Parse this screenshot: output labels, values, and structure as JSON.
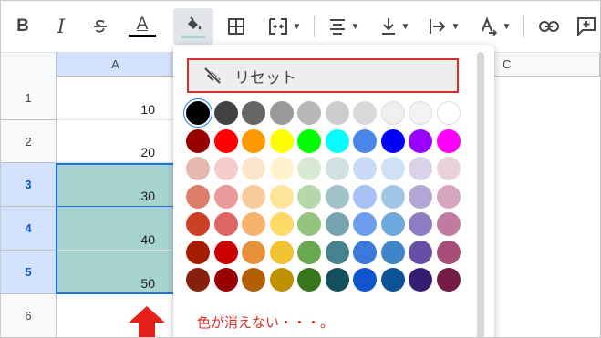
{
  "toolbar": {
    "bold": "B",
    "italic": "I",
    "text_color_letter": "A",
    "text_color_bar": "#000000",
    "fill_bar": "#a6d3cf",
    "buttons": [
      "bold-icon",
      "italic-icon",
      "strikethrough-icon",
      "text-color-icon",
      "fill-color-icon",
      "borders-icon",
      "merge-cells-icon",
      "horizontal-align-icon",
      "vertical-align-icon",
      "text-wrapping-icon",
      "text-rotation-icon",
      "insert-link-icon",
      "insert-comment-icon"
    ]
  },
  "columns": [
    {
      "label": "A",
      "selected": true
    },
    {
      "label": "C",
      "selected": false
    }
  ],
  "rows": [
    {
      "num": "1",
      "value": "10",
      "selected": false
    },
    {
      "num": "2",
      "value": "20",
      "selected": false
    },
    {
      "num": "3",
      "value": "30",
      "selected": true
    },
    {
      "num": "4",
      "value": "40",
      "selected": true
    },
    {
      "num": "5",
      "value": "50",
      "selected": true
    },
    {
      "num": "6",
      "value": "",
      "selected": false
    }
  ],
  "popup": {
    "reset_label": "リセット",
    "note": "色が消えない・・・。",
    "palette": [
      [
        "#000000",
        "#434343",
        "#666666",
        "#999999",
        "#b7b7b7",
        "#cccccc",
        "#d9d9d9",
        "#efefef",
        "#f3f3f3",
        "#ffffff"
      ],
      [
        "#980000",
        "#ff0000",
        "#ff9900",
        "#ffff00",
        "#00ff00",
        "#00ffff",
        "#4a86e8",
        "#0000ff",
        "#9900ff",
        "#ff00ff"
      ],
      [
        "#e6b8af",
        "#f4cccc",
        "#fce5cd",
        "#fff2cc",
        "#d9ead3",
        "#d0e0e3",
        "#c9daf8",
        "#cfe2f3",
        "#d9d2e9",
        "#ead1dc"
      ],
      [
        "#dd7e6b",
        "#ea9999",
        "#f9cb9c",
        "#ffe599",
        "#b6d7a8",
        "#a2c4c9",
        "#a4c2f4",
        "#9fc5e8",
        "#b4a7d6",
        "#d5a6bd"
      ],
      [
        "#cc4125",
        "#e06666",
        "#f6b26b",
        "#ffd966",
        "#93c47d",
        "#76a5af",
        "#6d9eeb",
        "#6fa8dc",
        "#8e7cc3",
        "#c27ba0"
      ],
      [
        "#a61c00",
        "#cc0000",
        "#e69138",
        "#f1c232",
        "#6aa84f",
        "#45818e",
        "#3c78d8",
        "#3d85c6",
        "#674ea7",
        "#a64d79"
      ],
      [
        "#85200c",
        "#990000",
        "#b45f06",
        "#bf9000",
        "#38761d",
        "#134f5c",
        "#1155cc",
        "#0b5394",
        "#351c75",
        "#741b47"
      ]
    ]
  },
  "colors": {
    "selection": "#1a73e8",
    "selected_fill": "#a6d3cf",
    "annotation": "#d93025",
    "arrow": "#e8201c"
  }
}
